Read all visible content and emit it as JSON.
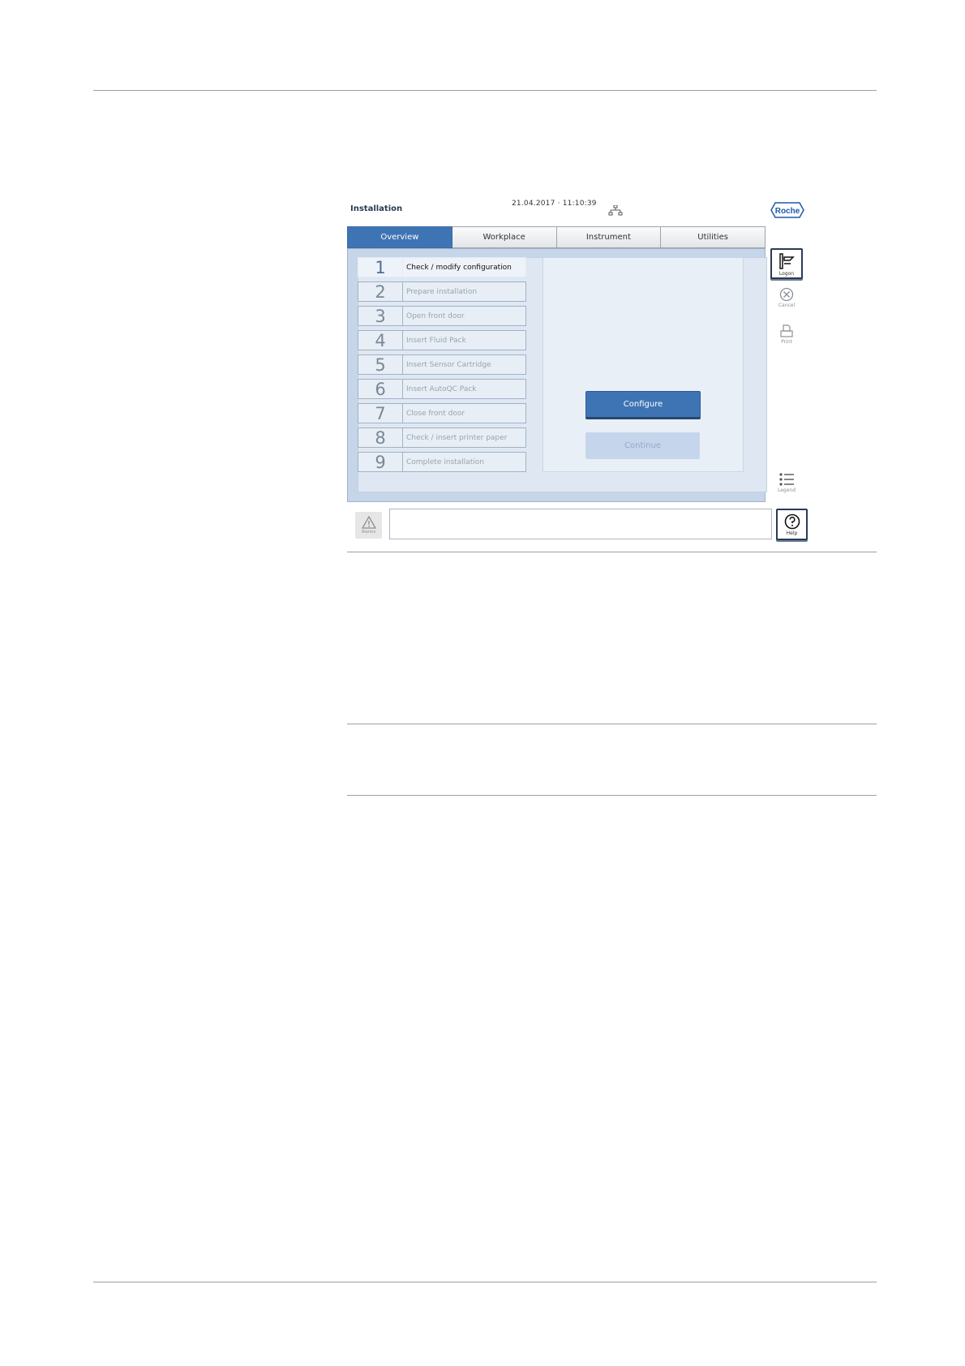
{
  "app": {
    "title": "Installation",
    "datetime": "21.04.2017 · 11:10:39",
    "brand": "Roche"
  },
  "tabs": [
    {
      "label": "Overview",
      "active": true
    },
    {
      "label": "Workplace",
      "active": false
    },
    {
      "label": "Instrument",
      "active": false
    },
    {
      "label": "Utilities",
      "active": false
    }
  ],
  "steps": [
    {
      "number": "1",
      "label": "Check / modify configuration",
      "active": true
    },
    {
      "number": "2",
      "label": "Prepare installation",
      "active": false
    },
    {
      "number": "3",
      "label": "Open front door",
      "active": false
    },
    {
      "number": "4",
      "label": "Insert Fluid Pack",
      "active": false
    },
    {
      "number": "5",
      "label": "Insert Sensor Cartridge",
      "active": false
    },
    {
      "number": "6",
      "label": "Insert AutoQC Pack",
      "active": false
    },
    {
      "number": "7",
      "label": "Close front door",
      "active": false
    },
    {
      "number": "8",
      "label": "Check / insert printer paper",
      "active": false
    },
    {
      "number": "9",
      "label": "Complete installation",
      "active": false
    }
  ],
  "actions": {
    "configure_label": "Configure",
    "continue_label": "Continue"
  },
  "sidebar": {
    "logon_label": "Logon",
    "cancel_label": "Cancel",
    "print_label": "Print",
    "legend_label": "Legend"
  },
  "bottom": {
    "alarms_label": "Alarms",
    "help_label": "Help",
    "message": ""
  },
  "colors": {
    "accent": "#3f74b4",
    "panel": "#c6d6e8",
    "disabled_button": "#c5d6ec"
  }
}
